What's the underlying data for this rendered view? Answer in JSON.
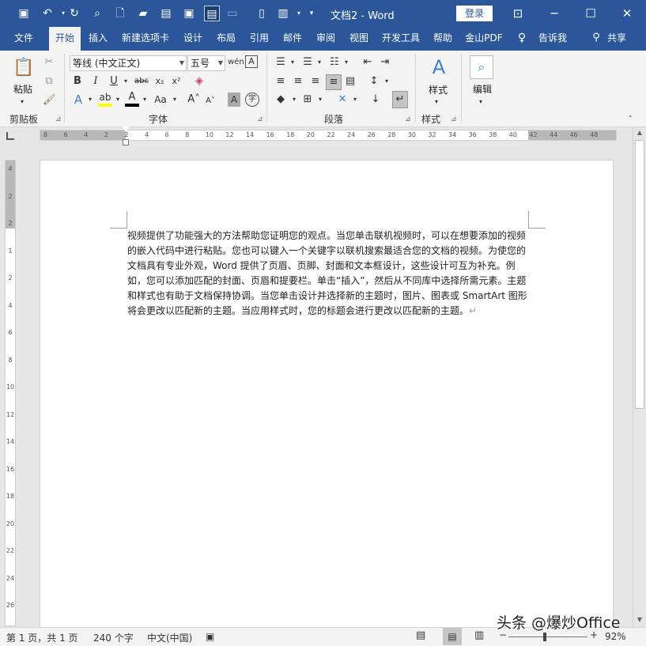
{
  "window": {
    "doc_title": "文档2 - Word",
    "login_label": "登录"
  },
  "quick_access": [
    {
      "name": "save-icon",
      "glyph": "💾"
    },
    {
      "name": "undo-icon",
      "glyph": "↶"
    },
    {
      "name": "redo-icon",
      "glyph": "↻"
    },
    {
      "name": "print-preview-icon",
      "glyph": "🔍"
    },
    {
      "name": "new-document-icon",
      "glyph": "🗋"
    },
    {
      "name": "open-folder-icon",
      "glyph": "📂"
    },
    {
      "name": "clipboard-icon",
      "glyph": "📋"
    },
    {
      "name": "screenshot-icon",
      "glyph": "▣"
    },
    {
      "name": "read-mode-icon",
      "glyph": "▤"
    },
    {
      "name": "page-layout-icon",
      "glyph": "▭"
    },
    {
      "name": "two-pages-icon",
      "glyph": "▯▯"
    },
    {
      "name": "paste-icon",
      "glyph": "📋"
    },
    {
      "name": "customize-icon",
      "glyph": "▾"
    }
  ],
  "tabs": [
    "文件",
    "开始",
    "插入",
    "新建选项卡",
    "设计",
    "布局",
    "引用",
    "邮件",
    "审阅",
    "视图",
    "开发工具",
    "帮助",
    "金山PDF",
    "告诉我",
    "共享"
  ],
  "active_tab": "开始",
  "ribbon": {
    "clipboard": {
      "label": "剪贴板",
      "paste_label": "粘贴"
    },
    "font": {
      "label": "字体",
      "font_name": "等线 (中文正文)",
      "font_size": "五号"
    },
    "paragraph": {
      "label": "段落"
    },
    "styles": {
      "label": "样式",
      "styles_button": "样式"
    },
    "editing": {
      "editing_button": "编辑"
    }
  },
  "ruler": {
    "h_numbers": [
      "8",
      "6",
      "4",
      "2",
      "2",
      "4",
      "6",
      "8",
      "10",
      "12",
      "14",
      "16",
      "18",
      "20",
      "22",
      "24",
      "26",
      "28",
      "30",
      "32",
      "34",
      "36",
      "38",
      "40",
      "42",
      "44",
      "46",
      "48"
    ],
    "v_numbers": [
      "4",
      "2",
      "2",
      "1",
      "2",
      "4",
      "6",
      "8",
      "10",
      "12",
      "14",
      "16",
      "18",
      "20",
      "22",
      "24",
      "26"
    ]
  },
  "document": {
    "body": "视频提供了功能强大的方法帮助您证明您的观点。当您单击联机视频时，可以在想要添加的视频的嵌入代码中进行粘贴。您也可以键入一个关键字以联机搜索最适合您的文档的视频。为使您的文档具有专业外观，Word 提供了页眉、页脚、封面和文本框设计，这些设计可互为补充。例如，您可以添加匹配的封面、页眉和提要栏。单击“插入”，然后从不同库中选择所需元素。主题和样式也有助于文档保持协调。当您单击设计并选择新的主题时，图片、图表或 SmartArt 图形将会更改以匹配新的主题。当应用样式时，您的标题会进行更改以匹配新的主题。",
    "paragraph_mark": "↵"
  },
  "status": {
    "page": "第 1 页，共 1 页",
    "words": "240 个字",
    "language": "中文(中国)",
    "zoom": "92%",
    "zoom_value": 92
  },
  "watermark": "头条 @爆炒Office",
  "colors": {
    "accent": "#2b579a",
    "ribbon_bg": "#f3f3f3",
    "highlight": "#ffff00",
    "font_color": "#ff0000"
  }
}
